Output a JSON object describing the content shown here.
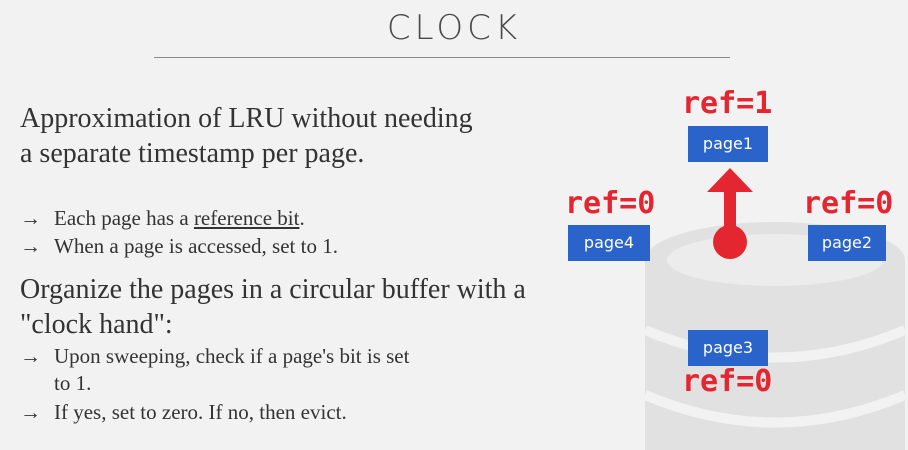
{
  "slide": {
    "title": "CLOCK"
  },
  "text": {
    "para1": "Approximation of LRU without needing a separate timestamp per page.",
    "bullet1_prefix": "Each page has a ",
    "bullet1_link": "reference bit",
    "bullet1_suffix": ".",
    "bullet2": "When a page is accessed, set to 1.",
    "para2": "Organize the pages in a circular buffer with a \"clock hand\":",
    "bullet3_line1": "Upon sweeping, check if a page's bit is set",
    "bullet3_line2": "to 1.",
    "bullet4": "If yes, set to zero. If no, then evict.",
    "arrow_glyph": "→"
  },
  "diagram": {
    "pages": [
      {
        "label": "page1",
        "ref": "ref=1"
      },
      {
        "label": "page2",
        "ref": "ref=0"
      },
      {
        "label": "page3",
        "ref": "ref=0"
      },
      {
        "label": "page4",
        "ref": "ref=0"
      }
    ],
    "colors": {
      "page_fill": "#2a63c9",
      "ref_text": "#e3262f",
      "clock_hand": "#e3262f"
    }
  }
}
